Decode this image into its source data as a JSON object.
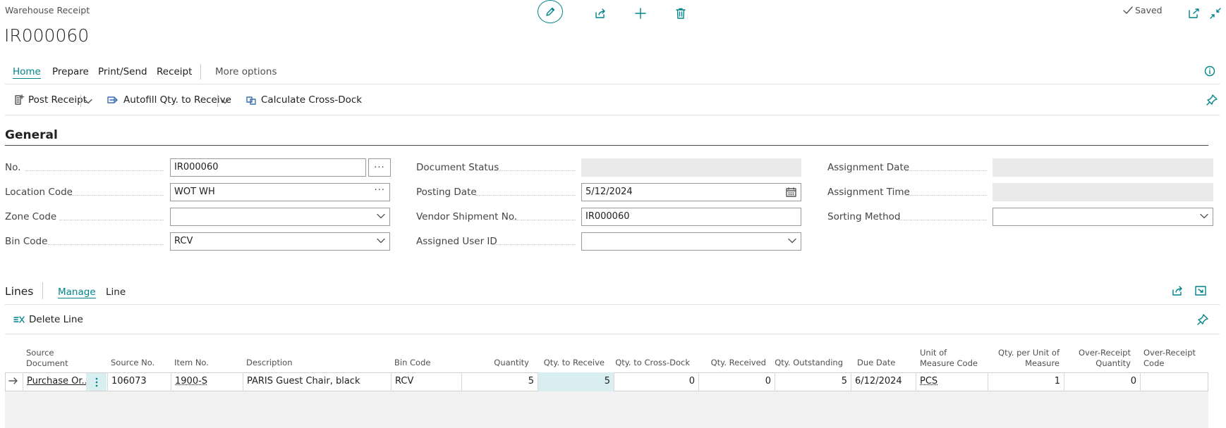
{
  "header": {
    "page_type": "Warehouse Receipt",
    "title": "IR000060",
    "saved_label": "Saved",
    "top_actions": [
      "pencil-icon",
      "share-icon",
      "plus-icon",
      "trash-icon"
    ]
  },
  "menu": {
    "tabs": [
      "Home",
      "Prepare",
      "Print/Send",
      "Receipt"
    ],
    "more_options": "More options",
    "actions": {
      "post_receipt": "Post Receipt",
      "autofill": "Autofill Qty. to Receive",
      "cross_dock": "Calculate Cross-Dock"
    }
  },
  "general": {
    "title": "General",
    "fields": {
      "no": {
        "label": "No.",
        "value": "IR000060"
      },
      "location_code": {
        "label": "Location Code",
        "value": "WOT WH"
      },
      "zone_code": {
        "label": "Zone Code",
        "value": ""
      },
      "bin_code": {
        "label": "Bin Code",
        "value": "RCV"
      },
      "document_status": {
        "label": "Document Status",
        "value": ""
      },
      "posting_date": {
        "label": "Posting Date",
        "value": "5/12/2024"
      },
      "vendor_shipment_no": {
        "label": "Vendor Shipment No.",
        "value": "IR000060"
      },
      "assigned_user_id": {
        "label": "Assigned User ID",
        "value": ""
      },
      "assignment_date": {
        "label": "Assignment Date",
        "value": ""
      },
      "assignment_time": {
        "label": "Assignment Time",
        "value": ""
      },
      "sorting_method": {
        "label": "Sorting Method",
        "value": ""
      }
    }
  },
  "lines": {
    "title": "Lines",
    "tabs": [
      "Manage",
      "Line"
    ],
    "delete_line": "Delete Line",
    "columns": {
      "source_document": "Source Document",
      "source_no": "Source No.",
      "item_no": "Item No.",
      "description": "Description",
      "bin_code": "Bin Code",
      "quantity": "Quantity",
      "qty_to_receive": "Qty. to Receive",
      "qty_to_cross_dock": "Qty. to Cross-Dock",
      "qty_received": "Qty. Received",
      "qty_outstanding": "Qty. Outstanding",
      "due_date": "Due Date",
      "uom_code": "Unit of Measure Code",
      "qty_per_uom": "Qty. per Unit of Measure",
      "over_receipt_qty": "Over-Receipt Quantity",
      "over_receipt_code": "Over-Receipt Code"
    },
    "rows": [
      {
        "source_document": "Purchase Or...",
        "source_no": "106073",
        "item_no": "1900-S",
        "description": "PARIS Guest Chair, black",
        "bin_code": "RCV",
        "quantity": "5",
        "qty_to_receive": "5",
        "qty_to_cross_dock": "0",
        "qty_received": "0",
        "qty_outstanding": "5",
        "due_date": "6/12/2024",
        "uom_code": "PCS",
        "qty_per_uom": "1",
        "over_receipt_qty": "0",
        "over_receipt_code": ""
      }
    ]
  },
  "colors": {
    "accent": "#008489",
    "selected_cell": "#d8eef0",
    "readonly": "#eaeaea"
  }
}
